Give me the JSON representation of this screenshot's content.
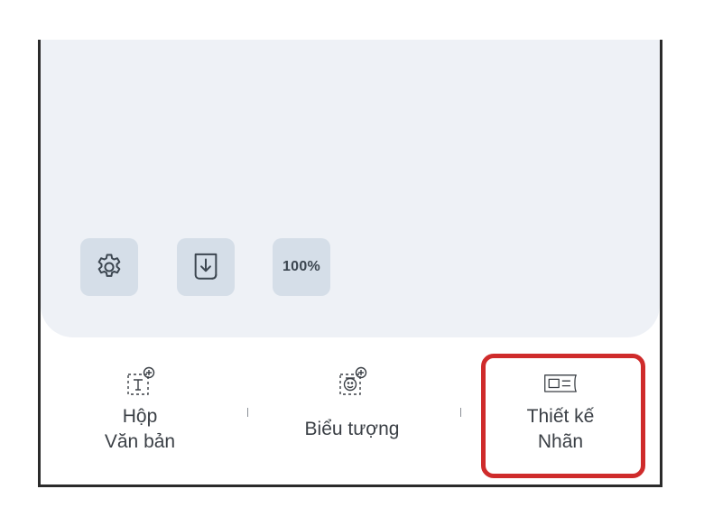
{
  "toolbar": {
    "settings_icon": "gear-icon",
    "export_icon": "download-file-icon",
    "zoom_label": "100%"
  },
  "bottom_bar": {
    "items": [
      {
        "label": "Hộp\nVăn bản",
        "icon": "text-box-add-icon"
      },
      {
        "label": "Biểu tượng",
        "icon": "emoji-add-icon"
      },
      {
        "label": "Thiết kế\nNhãn",
        "icon": "label-design-icon"
      }
    ]
  },
  "colors": {
    "canvas_bg": "#eef1f6",
    "button_bg": "#d5dee8",
    "highlight": "#cf2b2b",
    "frame_border": "#2b2b2b"
  }
}
